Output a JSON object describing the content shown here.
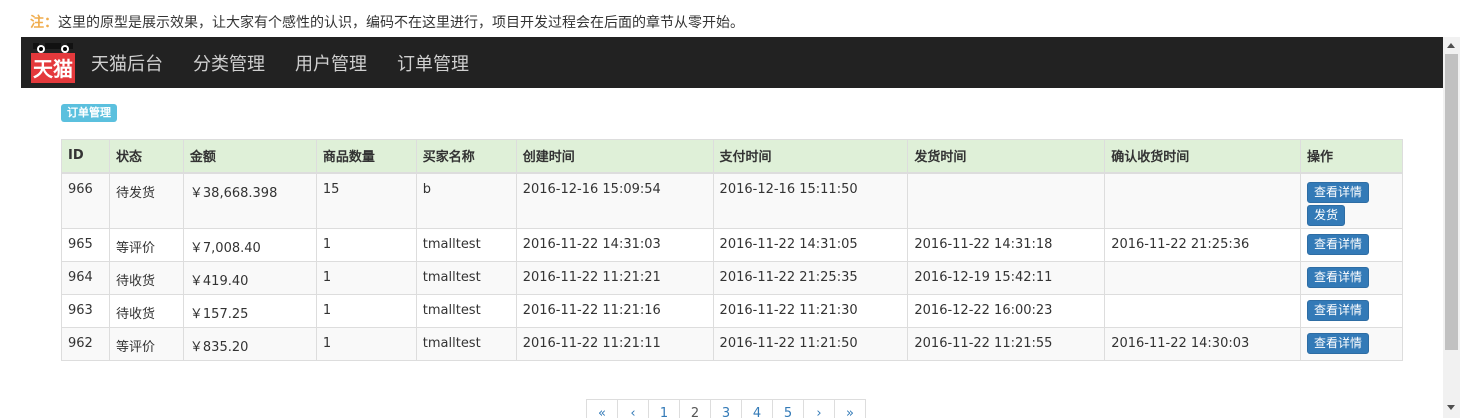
{
  "note": {
    "prefix": "注：",
    "text": "这里的原型是展示效果，让大家有个感性的认识，编码不在这里进行，项目开发过程会在后面的章节从零开始。"
  },
  "navbar": {
    "logo_text": "天猫",
    "items": [
      "天猫后台",
      "分类管理",
      "用户管理",
      "订单管理"
    ]
  },
  "badge": "订单管理",
  "table": {
    "headers": [
      "ID",
      "状态",
      "金额",
      "商品数量",
      "买家名称",
      "创建时间",
      "支付时间",
      "发货时间",
      "确认收货时间",
      "操作"
    ],
    "rows": [
      {
        "id": "966",
        "status": "待发货",
        "amount": "￥38,668.398",
        "qty": "15",
        "buyer": "b",
        "created": "2016-12-16 15:09:54",
        "paid": "2016-12-16 15:11:50",
        "shipped": "",
        "confirmed": "",
        "action": "查看详情",
        "action2": "发货"
      },
      {
        "id": "965",
        "status": "等评价",
        "amount": "￥7,008.40",
        "qty": "1",
        "buyer": "tmalltest",
        "created": "2016-11-22 14:31:03",
        "paid": "2016-11-22 14:31:05",
        "shipped": "2016-11-22 14:31:18",
        "confirmed": "2016-11-22 21:25:36",
        "action": "查看详情"
      },
      {
        "id": "964",
        "status": "待收货",
        "amount": "￥419.40",
        "qty": "1",
        "buyer": "tmalltest",
        "created": "2016-11-22 11:21:21",
        "paid": "2016-11-22 21:25:35",
        "shipped": "2016-12-19 15:42:11",
        "confirmed": "",
        "action": "查看详情"
      },
      {
        "id": "963",
        "status": "待收货",
        "amount": "￥157.25",
        "qty": "1",
        "buyer": "tmalltest",
        "created": "2016-11-22 11:21:16",
        "paid": "2016-11-22 11:21:30",
        "shipped": "2016-12-22 16:00:23",
        "confirmed": "",
        "action": "查看详情"
      },
      {
        "id": "962",
        "status": "等评价",
        "amount": "￥835.20",
        "qty": "1",
        "buyer": "tmalltest",
        "created": "2016-11-22 11:21:11",
        "paid": "2016-11-22 11:21:50",
        "shipped": "2016-11-22 11:21:55",
        "confirmed": "2016-11-22 14:30:03",
        "action": "查看详情"
      }
    ]
  },
  "pagination": [
    "«",
    "‹",
    "1",
    "2",
    "3",
    "4",
    "5",
    "›",
    "»"
  ],
  "colors": {
    "navbar_bg": "#222222",
    "header_bg": "#dff0d8",
    "badge_bg": "#5bc0de",
    "button_bg": "#337ab7",
    "note_prefix": "#f0ad4e"
  }
}
